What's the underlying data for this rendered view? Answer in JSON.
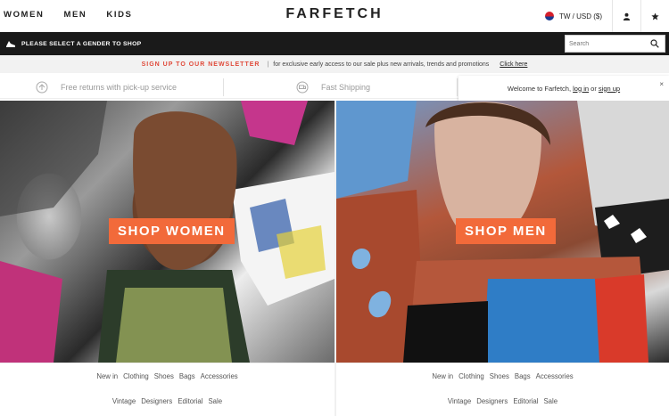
{
  "header": {
    "nav": [
      "WOMEN",
      "MEN",
      "KIDS"
    ],
    "logo": "FARFETCH",
    "locale": "TW / USD ($)",
    "account_icon": "user-icon",
    "wishlist_icon": "star-icon"
  },
  "promo_bar": {
    "gender_prompt": "PLEASE SELECT A GENDER TO SHOP",
    "search_placeholder": "Search"
  },
  "newsletter": {
    "cta": "SIGN UP TO OUR NEWSLETTER",
    "separator": "|",
    "text": "for exclusive early access to our sale plus new arrivals, trends and promotions",
    "link": "Click here"
  },
  "benefits": [
    {
      "icon": "return-icon",
      "label": "Free returns with pick-up service"
    },
    {
      "icon": "truck-icon",
      "label": "Fast Shipping"
    }
  ],
  "welcome": {
    "text": "Welcome to Farfetch,",
    "login": "log in",
    "or": "or",
    "signup": "sign up",
    "close": "×"
  },
  "hero": {
    "women_cta": "SHOP WOMEN",
    "men_cta": "SHOP MEN"
  },
  "categories": {
    "women": {
      "row1": [
        "New in",
        "Clothing",
        "Shoes",
        "Bags",
        "Accessories"
      ],
      "row2": [
        "Vintage",
        "Designers",
        "Editorial",
        "Sale"
      ]
    },
    "men": {
      "row1": [
        "New in",
        "Clothing",
        "Shoes",
        "Bags",
        "Accessories"
      ],
      "row2": [
        "Vintage",
        "Designers",
        "Editorial",
        "Sale"
      ]
    }
  },
  "colors": {
    "accent": "#f26a3a",
    "newsletter_cta": "#e04a3a",
    "black_bar": "#1a1a1a"
  }
}
